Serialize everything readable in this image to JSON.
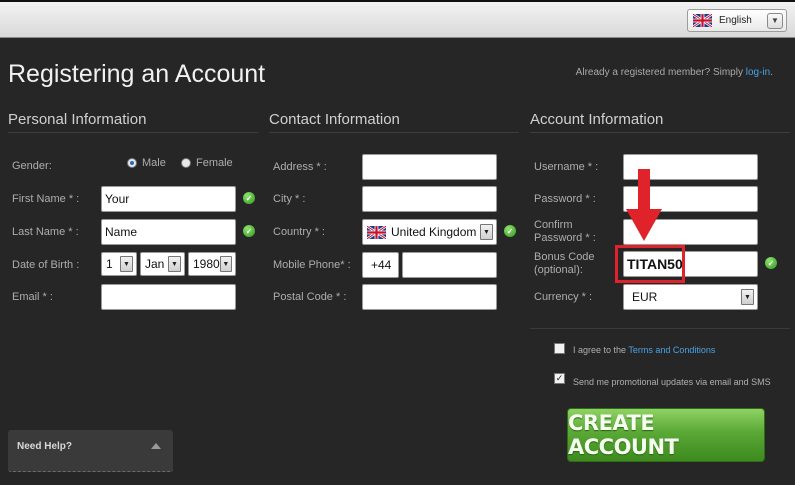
{
  "language": {
    "selected": "English"
  },
  "page": {
    "title": "Registering an Account",
    "member_note": "Already a registered member? Simply",
    "login_link": "log-in",
    "login_tail": "."
  },
  "personal": {
    "title": "Personal Information",
    "gender_label": "Gender:",
    "male": "Male",
    "female": "Female",
    "gender_selected": "Male",
    "first_name_label": "First Name * :",
    "first_name_value": "Your",
    "last_name_label": "Last Name * :",
    "last_name_value": "Name",
    "dob_label": "Date of Birth :",
    "dob_day": "1",
    "dob_month": "Jan",
    "dob_year": "1980",
    "email_label": "Email * :",
    "email_value": ""
  },
  "contact": {
    "title": "Contact Information",
    "address_label": "Address * :",
    "city_label": "City * :",
    "country_label": "Country * :",
    "country_value": "United Kingdom",
    "mobile_label": "Mobile Phone* :",
    "mobile_prefix": "+44",
    "postal_label": "Postal Code * :"
  },
  "account": {
    "title": "Account Information",
    "username_label": "Username * :",
    "password_label": "Password * :",
    "confirm_label_1": "Confirm",
    "confirm_label_2": "Password * :",
    "bonus_label_1": "Bonus Code",
    "bonus_label_2": "(optional):",
    "bonus_value": "TITAN50",
    "currency_label": "Currency * :",
    "currency_value": "EUR"
  },
  "agreements": {
    "terms_prefix": "I agree to the",
    "terms_link": "Terms and Conditions",
    "terms_checked": false,
    "promo_text": "Send me promotional updates via email and SMS",
    "promo_checked": true
  },
  "buttons": {
    "create_account": "CREATE ACCOUNT"
  },
  "help": {
    "label": "Need Help?"
  },
  "colors": {
    "background": "#262626",
    "link": "#4aa3e6",
    "button_green": "#5aa836",
    "highlight_red": "#e0222a",
    "valid_green": "#3aa52a"
  },
  "icons": {
    "flag": "uk-flag-icon",
    "valid": "check-circle-icon",
    "annotation": "red-arrow-down-icon"
  }
}
